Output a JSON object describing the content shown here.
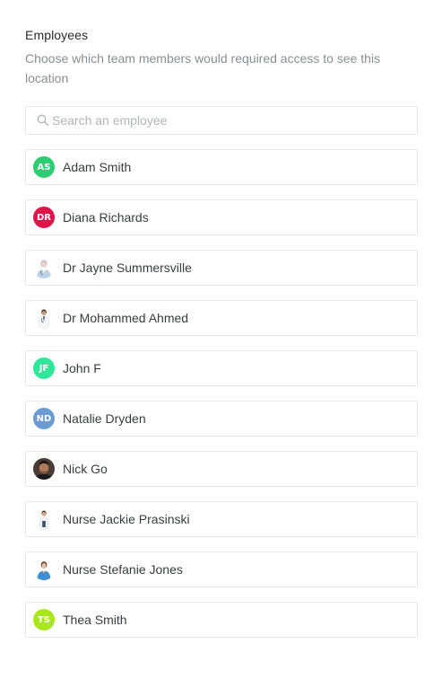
{
  "section": {
    "title": "Employees",
    "description": "Choose which team members would required access to see this location"
  },
  "search": {
    "placeholder": "Search an employee",
    "icon": "search-icon"
  },
  "employees": [
    {
      "name": "Adam Smith",
      "initials": "AS",
      "avatar_type": "initials",
      "color": "#2ecc71"
    },
    {
      "name": "Diana Richards",
      "initials": "DR",
      "avatar_type": "initials",
      "color": "#e0134a"
    },
    {
      "name": "Dr Jayne Summersville",
      "avatar_type": "photo",
      "avatar_icon": "doctor-female-photo"
    },
    {
      "name": "Dr Mohammed Ahmed",
      "avatar_type": "photo",
      "avatar_icon": "doctor-male-photo"
    },
    {
      "name": "John F",
      "initials": "JF",
      "avatar_type": "initials",
      "color": "#2ee89a"
    },
    {
      "name": "Natalie Dryden",
      "initials": "ND",
      "avatar_type": "initials",
      "color": "#6b9bd1"
    },
    {
      "name": "Nick Go",
      "avatar_type": "photo",
      "avatar_icon": "man-portrait-photo"
    },
    {
      "name": "Nurse Jackie Prasinski",
      "avatar_type": "photo",
      "avatar_icon": "nurse-male-photo"
    },
    {
      "name": "Nurse Stefanie Jones",
      "avatar_type": "photo",
      "avatar_icon": "nurse-female-photo"
    },
    {
      "name": "Thea Smith",
      "initials": "TS",
      "avatar_type": "initials",
      "color": "#a8e61d"
    }
  ]
}
